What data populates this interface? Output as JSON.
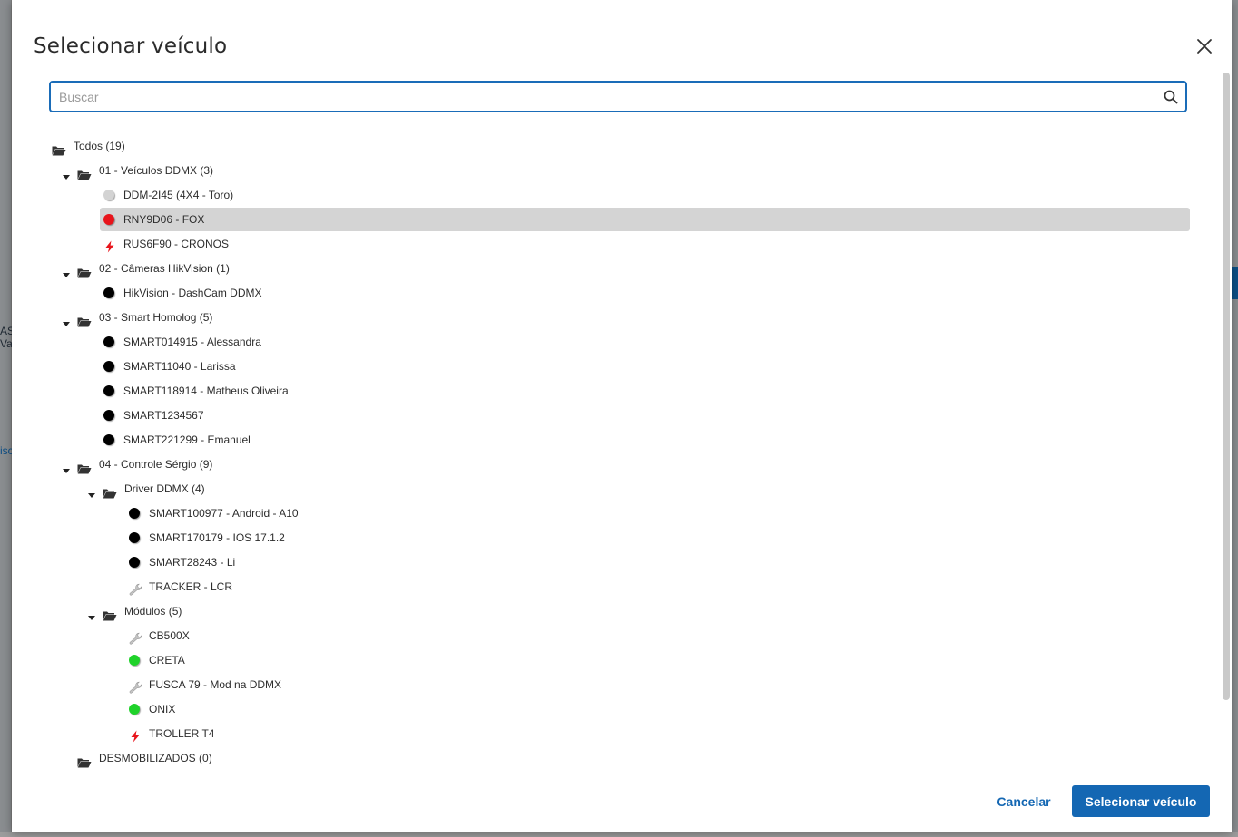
{
  "dialog": {
    "title": "Selecionar veículo",
    "search_placeholder": "Buscar",
    "cancel_label": "Cancelar",
    "confirm_label": "Selecionar veículo"
  },
  "background": {
    "left_texts": [
      "AS",
      "Va",
      "isc"
    ],
    "accent_color": "#0d4f86"
  },
  "colors": {
    "primary": "#1467b3",
    "selected_row": "#d4d4d4",
    "status_red": "#e8141b",
    "status_green": "#1fd22a",
    "status_black": "#000000",
    "status_gray": "#d3d3d3"
  },
  "tree": [
    {
      "label": "Todos (19)",
      "type": "folder",
      "level": 0,
      "expanded": true
    },
    {
      "label": "01 - Veículos DDMX (3)",
      "type": "folder",
      "level": 1,
      "expanded": true
    },
    {
      "label": "DDM-2I45 (4X4 - Toro)",
      "type": "vehicle",
      "level": 2,
      "icon": "dot-gray"
    },
    {
      "label": "RNY9D06 - FOX",
      "type": "vehicle",
      "level": 2,
      "icon": "dot-red",
      "selected": true
    },
    {
      "label": "RUS6F90 - CRONOS",
      "type": "vehicle",
      "level": 2,
      "icon": "bolt-red"
    },
    {
      "label": "02 - Câmeras HikVision (1)",
      "type": "folder",
      "level": 1,
      "expanded": true
    },
    {
      "label": "HikVision - DashCam DDMX",
      "type": "vehicle",
      "level": 2,
      "icon": "dot-black"
    },
    {
      "label": "03 - Smart Homolog (5)",
      "type": "folder",
      "level": 1,
      "expanded": true
    },
    {
      "label": "SMART014915 - Alessandra",
      "type": "vehicle",
      "level": 2,
      "icon": "dot-black"
    },
    {
      "label": "SMART11040 - Larissa",
      "type": "vehicle",
      "level": 2,
      "icon": "dot-black"
    },
    {
      "label": "SMART118914 - Matheus Oliveira",
      "type": "vehicle",
      "level": 2,
      "icon": "dot-black"
    },
    {
      "label": "SMART1234567",
      "type": "vehicle",
      "level": 2,
      "icon": "dot-black"
    },
    {
      "label": "SMART221299 - Emanuel",
      "type": "vehicle",
      "level": 2,
      "icon": "dot-black"
    },
    {
      "label": "04 - Controle Sérgio (9)",
      "type": "folder",
      "level": 1,
      "expanded": true
    },
    {
      "label": "Driver DDMX (4)",
      "type": "folder",
      "level": 2,
      "expanded": true
    },
    {
      "label": "SMART100977 - Android - A10",
      "type": "vehicle",
      "level": 3,
      "icon": "dot-black"
    },
    {
      "label": "SMART170179 - IOS 17.1.2",
      "type": "vehicle",
      "level": 3,
      "icon": "dot-black"
    },
    {
      "label": "SMART28243 - Li",
      "type": "vehicle",
      "level": 3,
      "icon": "dot-black"
    },
    {
      "label": "TRACKER - LCR",
      "type": "vehicle",
      "level": 3,
      "icon": "wrench-gray"
    },
    {
      "label": "Módulos (5)",
      "type": "folder",
      "level": 2,
      "expanded": true
    },
    {
      "label": "CB500X",
      "type": "vehicle",
      "level": 3,
      "icon": "wrench-gray"
    },
    {
      "label": "CRETA",
      "type": "vehicle",
      "level": 3,
      "icon": "dot-green"
    },
    {
      "label": "FUSCA 79 - Mod na DDMX",
      "type": "vehicle",
      "level": 3,
      "icon": "wrench-gray"
    },
    {
      "label": "ONIX",
      "type": "vehicle",
      "level": 3,
      "icon": "dot-green"
    },
    {
      "label": "TROLLER T4",
      "type": "vehicle",
      "level": 3,
      "icon": "bolt-red"
    },
    {
      "label": "DESMOBILIZADOS (0)",
      "type": "folder",
      "level": 1,
      "expanded": false
    }
  ]
}
